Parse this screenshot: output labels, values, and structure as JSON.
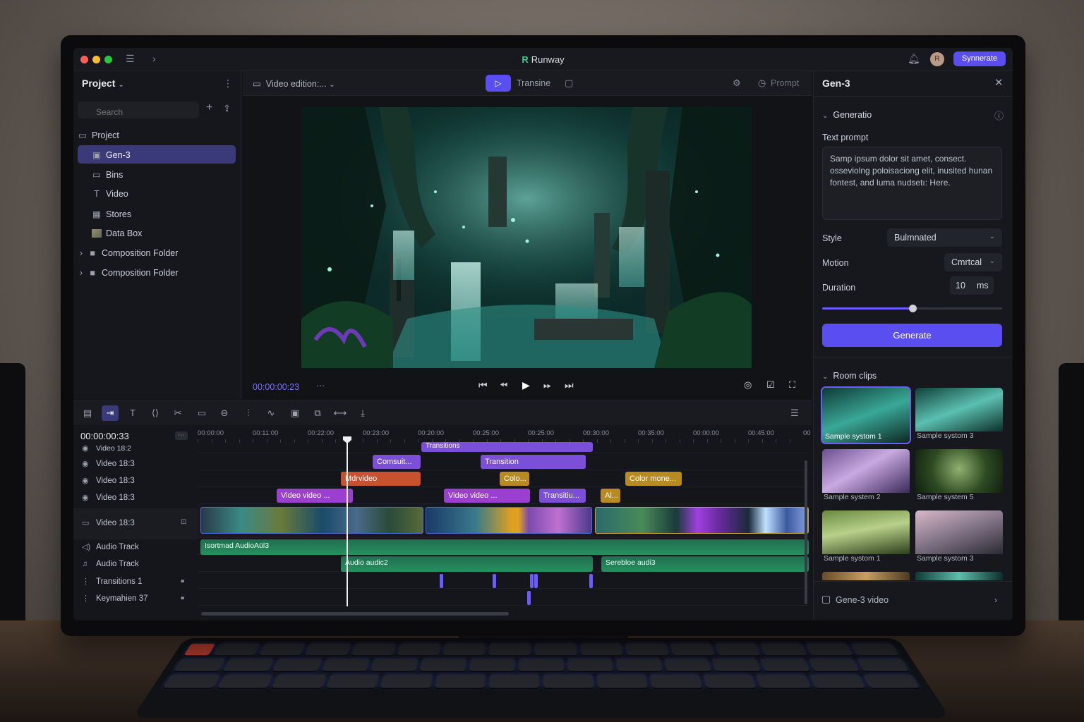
{
  "titlebar": {
    "app_name": "Runway",
    "avatar_initial": "R",
    "sync_label": "Synnerate"
  },
  "left_panel": {
    "title": "Project",
    "search_placeholder": "Search",
    "items": [
      {
        "label": "Project",
        "icon": "folder-icon"
      },
      {
        "label": "Gen-3",
        "icon": "gen-icon"
      },
      {
        "label": "Bins",
        "icon": "folder-icon"
      },
      {
        "label": "Video",
        "icon": "text-icon"
      },
      {
        "label": "Stores",
        "icon": "grid-icon"
      },
      {
        "label": "Data Box",
        "icon": "thumbnail-icon"
      },
      {
        "label": "Composition Folder",
        "icon": "folder-filled-icon"
      },
      {
        "label": "Composition Folder",
        "icon": "folder-filled-icon"
      }
    ]
  },
  "viewer": {
    "sequence_label": "Video edition:...",
    "transport_tab": "Transine",
    "prompt_label": "Prompt",
    "timecode": "00:00:00:23"
  },
  "right_panel": {
    "title": "Gen-3",
    "generation_section": "Generatio",
    "text_prompt_label": "Text prompt",
    "text_prompt_value": "Samp ipsum dolor sit amet, consect. osseviolng poloisaciong elit, inusited hunan fontest, and luma nudsetı: Here.",
    "style_label": "Style",
    "style_value": "Bulmnated",
    "motion_label": "Motion",
    "motion_value": "Cmrtcal",
    "duration_label": "Duration",
    "duration_value": "10",
    "duration_unit": "ms",
    "duration_slider_fraction": 0.5,
    "generate_label": "Generate",
    "room_clips_label": "Room clips",
    "clips": [
      {
        "caption": "Sample systom 1"
      },
      {
        "caption": "Sample systom 3"
      },
      {
        "caption": "Sample system 2"
      },
      {
        "caption": "Sample system 5"
      },
      {
        "caption": "Sample systom 1"
      },
      {
        "caption": "Sample systom 3"
      }
    ],
    "gen_video_label": "Gene-3 video"
  },
  "timeline": {
    "current_time": "00:00:00:33",
    "ruler": [
      "00:00:00",
      "00:11:00",
      "00:22:00",
      "00:23:00",
      "00:20:00",
      "00:25:00",
      "00:25:00",
      "00:30:00",
      "00:35:00",
      "00:00:00",
      "00:45:00",
      "00"
    ],
    "tracks": [
      {
        "label": "Video 18:2"
      },
      {
        "label": "Video 18:3"
      },
      {
        "label": "Video 18:3"
      },
      {
        "label": "Video 18:3"
      },
      {
        "label": "Video 18:3"
      },
      {
        "label": "Audio Track"
      },
      {
        "label": "Audio Track"
      },
      {
        "label": "Transitions 1"
      },
      {
        "label": "Keymahien 37"
      }
    ],
    "clips": {
      "transitions_top": "Transitions",
      "comsuit": "Comsuit...",
      "transition": "Transition",
      "mdrvideo": "Mdrvideo",
      "colo": "Colo...",
      "color_mone": "Color mone...",
      "video_video_1": "Video video ...",
      "video_video_2": "Video video ...",
      "transitiu": "Transitiu...",
      "al": "Al...",
      "audio_1": "Isortmad AudioAül3",
      "audio_2": "Audio audic2",
      "audio_3": "Serebloe audi3"
    }
  },
  "colors": {
    "accent": "#5b4ef0",
    "clip_purple": "#7b4fd8",
    "clip_orange": "#c8522e",
    "clip_gold": "#b88a22",
    "audio_green": "#1f6e4f"
  }
}
